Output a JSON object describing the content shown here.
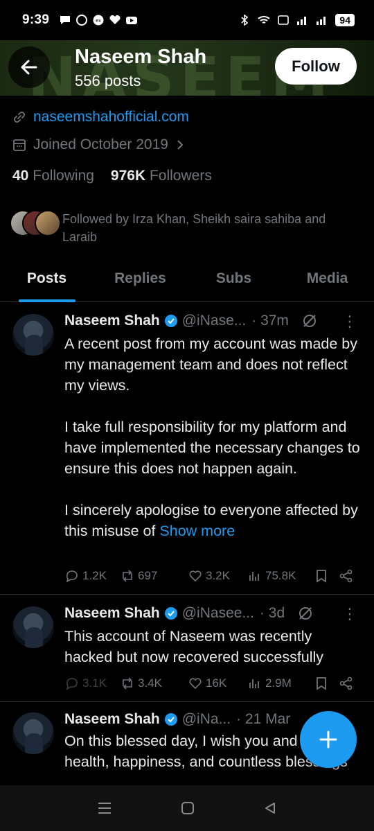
{
  "status_bar": {
    "time": "9:39",
    "battery": "94"
  },
  "header": {
    "banner_watermark": "NASEEM",
    "name": "Naseem Shah",
    "posts_count": "556 posts",
    "follow_label": "Follow"
  },
  "profile": {
    "website": "naseemshahofficial.com",
    "joined": "Joined October 2019",
    "following_count": "40",
    "following_label": "Following",
    "followers_count": "976K",
    "followers_label": "Followers",
    "followed_by": "Followed by Irza Khan, Sheikh saira sahiba and Laraib"
  },
  "tabs": [
    "Posts",
    "Replies",
    "Subs",
    "Media"
  ],
  "posts": [
    {
      "name": "Naseem Shah",
      "handle": "@iNase...",
      "time": "· 37m",
      "body": "A recent post from my account was made by my management team and does not reflect my views.\n\nI take full responsibility for my platform and have implemented the necessary changes to ensure this does not happen again.\n\nI sincerely apologise to everyone affected by this misuse of ",
      "show_more": "Show more",
      "replies": "1.2K",
      "reposts": "697",
      "likes": "3.2K",
      "views": "75.8K"
    },
    {
      "name": "Naseem Shah",
      "handle": "@iNasee...",
      "time": "· 3d",
      "body": "This account of Naseem was recently hacked but now recovered successfully",
      "replies": "3.1K",
      "reposts": "3.4K",
      "likes": "16K",
      "views": "2.9M"
    },
    {
      "name": "Naseem Shah",
      "handle": "@iNa...",
      "time": "· 21 Mar",
      "body": "On this blessed day, I wish you and family health, happiness, and countless blessings"
    }
  ],
  "colors": {
    "accent": "#1d9bf0",
    "background": "#000000",
    "muted": "#71767b"
  }
}
